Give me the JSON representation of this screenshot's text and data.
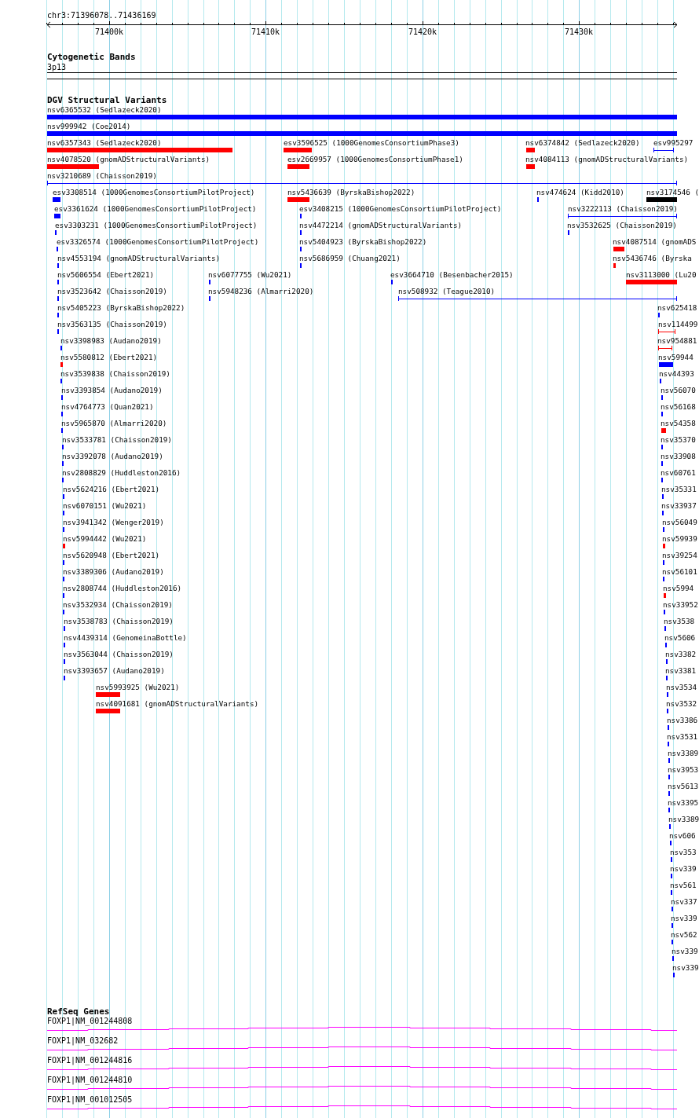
{
  "ruler": {
    "location": "chr3:71396078..71436169",
    "ticks": [
      "71400k",
      "71410k",
      "71420k",
      "71430k"
    ]
  },
  "tracks": [
    {
      "kind": "cytoband",
      "title": "Cytogenetic Bands",
      "band": "3p13"
    },
    {
      "kind": "variants",
      "title": "DGV Structural Variants",
      "rows": [
        [
          {
            "label": "nsv6365532 (Sedlazeck2020)",
            "color": "#0000ff",
            "kind": "box"
          }
        ],
        [
          {
            "label": "nsv999942 (Coe2014)",
            "color": "#0000ff",
            "kind": "box"
          }
        ],
        [
          {
            "label": "nsv6357343 (Sedlazeck2020)",
            "color": "#ff0000",
            "kind": "box"
          },
          {
            "label": "esv3596525 (1000GenomesConsortiumPhase3)",
            "color": "#ff0000",
            "kind": "box"
          },
          {
            "label": "nsv6374842 (Sedlazeck2020)",
            "color": "#ff0000",
            "kind": "box"
          },
          {
            "label": "esv995297",
            "color": "#0000ff",
            "kind": "line"
          }
        ],
        [
          {
            "label": "nsv4078520 (gnomADStructuralVariants)",
            "color": "#ff0000",
            "kind": "box"
          },
          {
            "label": "esv2669957 (1000GenomesConsortiumPhase1)",
            "color": "#ff0000",
            "kind": "box"
          },
          {
            "label": "nsv4084113 (gnomADStructuralVariants)",
            "color": "#ff0000",
            "kind": "box"
          }
        ],
        [
          {
            "label": "nsv3210689 (Chaisson2019)",
            "color": "#0000ff",
            "kind": "line"
          }
        ],
        [
          {
            "label": "esv3308514 (1000GenomesConsortiumPilotProject)",
            "color": "#0000ff",
            "kind": "box"
          },
          {
            "label": "nsv5436639 (ByrskaBishop2022)",
            "color": "#ff0000",
            "kind": "box"
          },
          {
            "label": "nsv474624 (Kidd2010)",
            "color": "#0000ff",
            "kind": "box"
          },
          {
            "label": "nsv3174546 (",
            "color": "#000000",
            "kind": "box"
          }
        ],
        [
          {
            "label": "esv3361624 (1000GenomesConsortiumPilotProject)",
            "color": "#0000ff",
            "kind": "box"
          },
          {
            "label": "esv3408215 (1000GenomesConsortiumPilotProject)",
            "color": "#0000ff",
            "kind": "box"
          },
          {
            "label": "nsv3222113 (Chaisson2019)",
            "color": "#0000ff",
            "kind": "line"
          }
        ],
        [
          {
            "label": "esv3303231 (1000GenomesConsortiumPilotProject)",
            "color": "#0000ff",
            "kind": "box"
          },
          {
            "label": "nsv4472214 (gnomADStructuralVariants)",
            "color": "#0000ff",
            "kind": "box"
          },
          {
            "label": "nsv3532625 (Chaisson2019)",
            "color": "#0000ff",
            "kind": "box"
          }
        ],
        [
          {
            "label": "esv3326574 (1000GenomesConsortiumPilotProject)",
            "color": "#0000ff",
            "kind": "box"
          },
          {
            "label": "nsv5404923 (ByrskaBishop2022)",
            "color": "#0000ff",
            "kind": "box"
          },
          {
            "label": "nsv4087514 (gnomADS",
            "color": "#ff0000",
            "kind": "box"
          }
        ],
        [
          {
            "label": "nsv4553194 (gnomADStructuralVariants)",
            "color": "#0000ff",
            "kind": "box"
          },
          {
            "label": "nsv5686959 (Chuang2021)",
            "color": "#0000ff",
            "kind": "box"
          },
          {
            "label": "nsv5436746 (Byrska",
            "color": "#ff0000",
            "kind": "box"
          }
        ],
        [
          {
            "label": "nsv5606554 (Ebert2021)",
            "color": "#0000ff",
            "kind": "box"
          },
          {
            "label": "nsv6077755 (Wu2021)",
            "color": "#0000ff",
            "kind": "box"
          },
          {
            "label": "esv3664710 (Besenbacher2015)",
            "color": "#0000ff",
            "kind": "box"
          },
          {
            "label": "nsv3113000 (Lu20",
            "color": "#ff0000",
            "kind": "box"
          }
        ],
        [
          {
            "label": "nsv3523642 (Chaisson2019)",
            "color": "#0000ff",
            "kind": "box"
          },
          {
            "label": "nsv5948236 (Almarri2020)",
            "color": "#0000ff",
            "kind": "box"
          },
          {
            "label": "nsv508932 (Teague2010)",
            "color": "#0000ff",
            "kind": "line"
          }
        ],
        [
          {
            "label": "nsv5405223 (ByrskaBishop2022)",
            "color": "#0000ff",
            "kind": "box"
          },
          {
            "label": "nsv625418",
            "color": "#0000ff",
            "kind": "box"
          }
        ],
        [
          {
            "label": "nsv3563135 (Chaisson2019)",
            "color": "#0000ff",
            "kind": "box"
          },
          {
            "label": "nsv114499",
            "color": "#ff0000",
            "kind": "line"
          }
        ],
        [
          {
            "label": "nsv3398983 (Audano2019)",
            "color": "#0000ff",
            "kind": "box"
          },
          {
            "label": "nsv954881",
            "color": "#ff0000",
            "kind": "line"
          }
        ],
        [
          {
            "label": "nsv5580812 (Ebert2021)",
            "color": "#ff0000",
            "kind": "box"
          },
          {
            "label": "nsv59944",
            "color": "#0000ff",
            "kind": "box"
          }
        ],
        [
          {
            "label": "nsv3539838 (Chaisson2019)",
            "color": "#0000ff",
            "kind": "box"
          },
          {
            "label": "nsv44393",
            "color": "#0000ff",
            "kind": "box"
          }
        ],
        [
          {
            "label": "nsv3393854 (Audano2019)",
            "color": "#0000ff",
            "kind": "box"
          },
          {
            "label": "nsv56070",
            "color": "#0000ff",
            "kind": "box"
          }
        ],
        [
          {
            "label": "nsv4764773 (Quan2021)",
            "color": "#0000ff",
            "kind": "box"
          },
          {
            "label": "nsv56168",
            "color": "#0000ff",
            "kind": "box"
          }
        ],
        [
          {
            "label": "nsv5965870 (Almarri2020)",
            "color": "#0000ff",
            "kind": "box"
          },
          {
            "label": "nsv54358",
            "color": "#ff0000",
            "kind": "box"
          }
        ],
        [
          {
            "label": "nsv3533781 (Chaisson2019)",
            "color": "#0000ff",
            "kind": "box"
          },
          {
            "label": "nsv35370",
            "color": "#0000ff",
            "kind": "box"
          }
        ],
        [
          {
            "label": "nsv3392078 (Audano2019)",
            "color": "#0000ff",
            "kind": "box"
          },
          {
            "label": "nsv33908",
            "color": "#0000ff",
            "kind": "box"
          }
        ],
        [
          {
            "label": "nsv2808829 (Huddleston2016)",
            "color": "#0000ff",
            "kind": "box"
          },
          {
            "label": "nsv60761",
            "color": "#0000ff",
            "kind": "box"
          }
        ],
        [
          {
            "label": "nsv5624216 (Ebert2021)",
            "color": "#0000ff",
            "kind": "box"
          },
          {
            "label": "nsv35331",
            "color": "#0000ff",
            "kind": "box"
          }
        ],
        [
          {
            "label": "nsv6070151 (Wu2021)",
            "color": "#0000ff",
            "kind": "box"
          },
          {
            "label": "nsv33937",
            "color": "#0000ff",
            "kind": "box"
          }
        ],
        [
          {
            "label": "nsv3941342 (Wenger2019)",
            "color": "#0000ff",
            "kind": "box"
          },
          {
            "label": "nsv56049",
            "color": "#0000ff",
            "kind": "box"
          }
        ],
        [
          {
            "label": "nsv5994442 (Wu2021)",
            "color": "#ff0000",
            "kind": "box"
          },
          {
            "label": "nsv59939",
            "color": "#ff0000",
            "kind": "box"
          }
        ],
        [
          {
            "label": "nsv5620948 (Ebert2021)",
            "color": "#0000ff",
            "kind": "box"
          },
          {
            "label": "nsv39254",
            "color": "#0000ff",
            "kind": "box"
          }
        ],
        [
          {
            "label": "nsv3389306 (Audano2019)",
            "color": "#0000ff",
            "kind": "box"
          },
          {
            "label": "nsv56101",
            "color": "#0000ff",
            "kind": "box"
          }
        ],
        [
          {
            "label": "nsv2808744 (Huddleston2016)",
            "color": "#0000ff",
            "kind": "box"
          },
          {
            "label": "nsv5994",
            "color": "#ff0000",
            "kind": "box"
          }
        ],
        [
          {
            "label": "nsv3532934 (Chaisson2019)",
            "color": "#0000ff",
            "kind": "box"
          },
          {
            "label": "nsv33952",
            "color": "#0000ff",
            "kind": "box"
          }
        ],
        [
          {
            "label": "nsv3538783 (Chaisson2019)",
            "color": "#0000ff",
            "kind": "box"
          },
          {
            "label": "nsv3538",
            "color": "#0000ff",
            "kind": "box"
          }
        ],
        [
          {
            "label": "nsv4439314 (GenomeinaBottle)",
            "color": "#0000ff",
            "kind": "box"
          },
          {
            "label": "nsv5606",
            "color": "#0000ff",
            "kind": "box"
          }
        ],
        [
          {
            "label": "nsv3563044 (Chaisson2019)",
            "color": "#0000ff",
            "kind": "box"
          },
          {
            "label": "nsv3382",
            "color": "#0000ff",
            "kind": "box"
          }
        ],
        [
          {
            "label": "nsv3393657 (Audano2019)",
            "color": "#0000ff",
            "kind": "box"
          },
          {
            "label": "nsv3381",
            "color": "#0000ff",
            "kind": "box"
          }
        ],
        [
          {
            "label": "nsv5993925 (Wu2021)",
            "color": "#ff0000",
            "kind": "box"
          },
          {
            "label": "nsv3534",
            "color": "#0000ff",
            "kind": "box"
          }
        ],
        [
          {
            "label": "nsv4091681 (gnomADStructuralVariants)",
            "color": "#ff0000",
            "kind": "box"
          },
          {
            "label": "nsv3532",
            "color": "#0000ff",
            "kind": "box"
          }
        ],
        [
          {
            "label": "nsv3386",
            "color": "#0000ff",
            "kind": "box"
          }
        ],
        [
          {
            "label": "nsv3531",
            "color": "#0000ff",
            "kind": "box"
          }
        ],
        [
          {
            "label": "nsv3389",
            "color": "#0000ff",
            "kind": "box"
          }
        ],
        [
          {
            "label": "nsv3953",
            "color": "#0000ff",
            "kind": "box"
          }
        ],
        [
          {
            "label": "nsv5613",
            "color": "#0000ff",
            "kind": "box"
          }
        ],
        [
          {
            "label": "nsv3395",
            "color": "#0000ff",
            "kind": "box"
          }
        ],
        [
          {
            "label": "nsv3389",
            "color": "#0000ff",
            "kind": "box"
          }
        ],
        [
          {
            "label": "nsv606",
            "color": "#0000ff",
            "kind": "box"
          }
        ],
        [
          {
            "label": "nsv353",
            "color": "#0000ff",
            "kind": "box"
          }
        ],
        [
          {
            "label": "nsv339",
            "color": "#0000ff",
            "kind": "box"
          }
        ],
        [
          {
            "label": "nsv561",
            "color": "#0000ff",
            "kind": "box"
          }
        ],
        [
          {
            "label": "nsv337",
            "color": "#0000ff",
            "kind": "box"
          }
        ],
        [
          {
            "label": "nsv339",
            "color": "#0000ff",
            "kind": "box"
          }
        ],
        [
          {
            "label": "nsv562",
            "color": "#0000ff",
            "kind": "box"
          }
        ],
        [
          {
            "label": "nsv339",
            "color": "#0000ff",
            "kind": "box"
          }
        ],
        [
          {
            "label": "nsv339",
            "color": "#0000ff",
            "kind": "box"
          }
        ]
      ]
    },
    {
      "kind": "genes",
      "title": "RefSeq Genes",
      "genes": [
        {
          "label": "FOXP1|NM_001244808"
        },
        {
          "label": "FOXP1|NM_032682"
        },
        {
          "label": "FOXP1|NM_001244816"
        },
        {
          "label": "FOXP1|NM_001244810"
        },
        {
          "label": "FOXP1|NM_001012505"
        }
      ]
    }
  ]
}
